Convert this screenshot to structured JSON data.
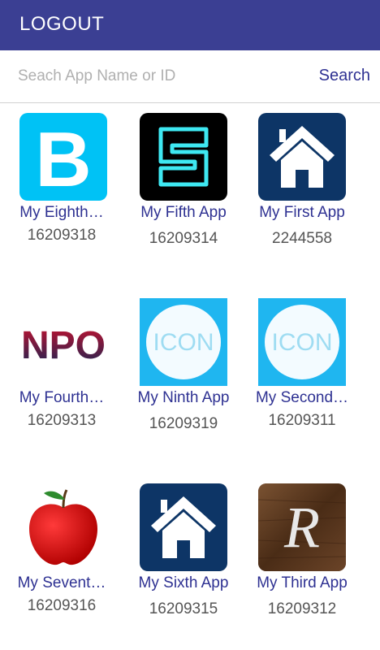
{
  "header": {
    "logout_label": "LOGOUT",
    "bar_color": "#3b3f93"
  },
  "search": {
    "placeholder": "Seach App Name or ID",
    "value": "",
    "button_label": "Search"
  },
  "apps": [
    {
      "name": "My Eighth…",
      "id": "16209318",
      "icon": "letter-b-icon"
    },
    {
      "name": "My Fifth App",
      "id": "16209314",
      "icon": "neon-e-icon"
    },
    {
      "name": "My First App",
      "id": "2244558",
      "icon": "house-icon"
    },
    {
      "name": "My Fourth…",
      "id": "16209313",
      "icon": "npo-logo-icon"
    },
    {
      "name": "My Ninth App",
      "id": "16209319",
      "icon": "icon-placeholder-icon"
    },
    {
      "name": "My Second…",
      "id": "16209311",
      "icon": "icon-placeholder-icon"
    },
    {
      "name": "My Sevent…",
      "id": "16209316",
      "icon": "apple-icon"
    },
    {
      "name": "My Sixth App",
      "id": "16209315",
      "icon": "house-icon"
    },
    {
      "name": "My Third App",
      "id": "16209312",
      "icon": "wood-r-icon"
    }
  ],
  "icon_text": {
    "npo": "NPO",
    "placeholder": "ICON",
    "b": "B",
    "r": "R"
  }
}
